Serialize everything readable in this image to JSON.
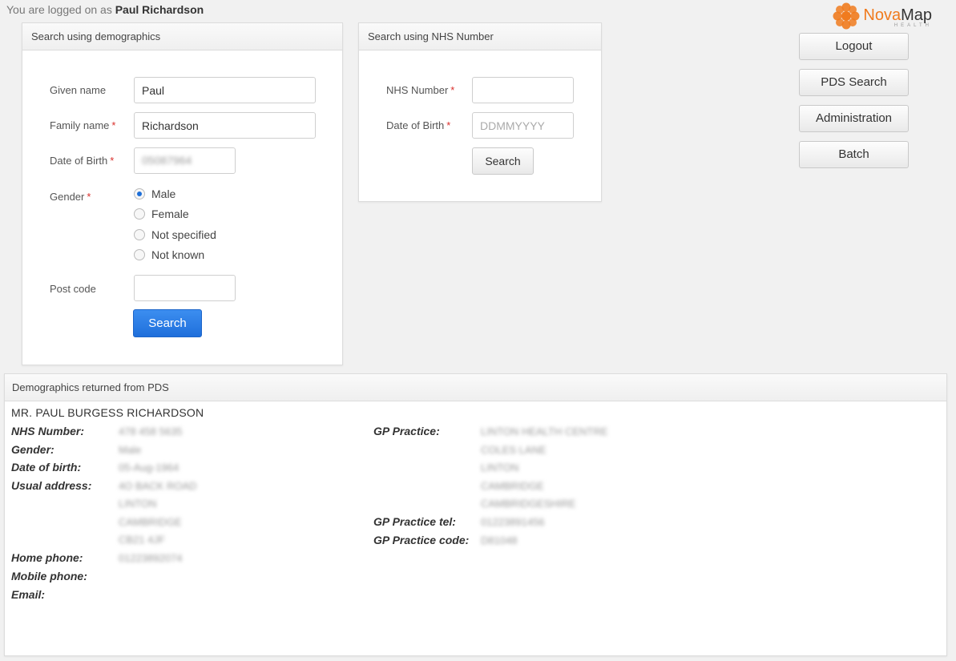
{
  "header": {
    "logged_prefix": "You are logged on as",
    "user_name": "Paul Richardson"
  },
  "logo": {
    "brand_a": "Nova",
    "brand_b": "Map",
    "sub": "HEALTH",
    "accent": "#f07b1e"
  },
  "demo_search": {
    "title": "Search using demographics",
    "given_name": {
      "label": "Given name",
      "value": "Paul"
    },
    "family_name": {
      "label": "Family name",
      "value": "Richardson"
    },
    "dob": {
      "label": "Date of Birth",
      "value": "05087964"
    },
    "gender": {
      "label": "Gender",
      "options": [
        "Male",
        "Female",
        "Not specified",
        "Not known"
      ],
      "selected": "Male"
    },
    "postcode": {
      "label": "Post code",
      "value": ""
    },
    "search_label": "Search"
  },
  "nhs_search": {
    "title": "Search using NHS Number",
    "nhs_number": {
      "label": "NHS Number",
      "value": ""
    },
    "dob": {
      "label": "Date of Birth",
      "placeholder": "DDMMYYYY"
    },
    "search_label": "Search"
  },
  "nav": {
    "logout": "Logout",
    "pds_search": "PDS Search",
    "administration": "Administration",
    "batch": "Batch"
  },
  "results": {
    "title": "Demographics returned from PDS",
    "patient_name": "MR. PAUL BURGESS RICHARDSON",
    "labels": {
      "nhs_number": "NHS Number:",
      "gender": "Gender:",
      "dob": "Date of birth:",
      "address": "Usual address:",
      "home_phone": "Home phone:",
      "mobile_phone": "Mobile phone:",
      "email": "Email:",
      "gp_practice": "GP Practice:",
      "gp_tel": "GP Practice tel:",
      "gp_code": "GP Practice code:"
    },
    "values": {
      "nhs_number": "478 458 5635",
      "gender": "Male",
      "dob": "05-Aug-1964",
      "address": [
        "4O BACK ROAD",
        "LINTON",
        "CAMBRIDGE",
        "CB21 4JF"
      ],
      "home_phone": "01223892074",
      "gp_practice": [
        "LINTON HEALTH CENTRE",
        "COLES LANE",
        "LINTON",
        "CAMBRIDGE",
        "CAMBRIDGESHIRE"
      ],
      "gp_tel": "01223891456",
      "gp_code": "D81048"
    }
  }
}
